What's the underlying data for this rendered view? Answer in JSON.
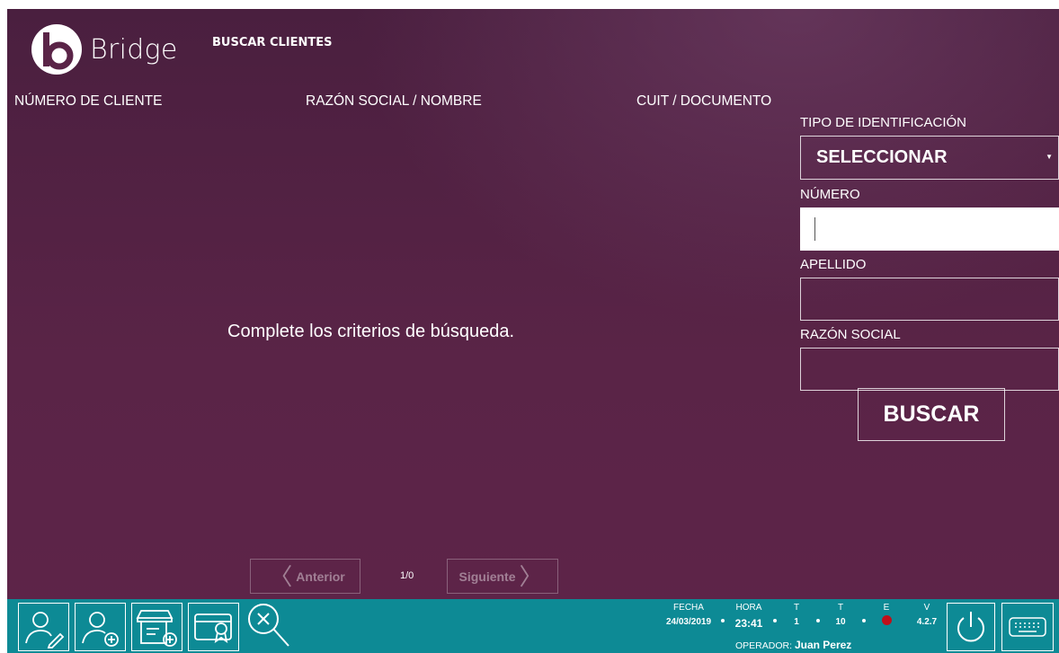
{
  "header": {
    "brand": "Bridge",
    "title": "BUSCAR CLIENTES"
  },
  "columns": [
    "NÚMERO DE CLIENTE",
    "RAZÓN SOCIAL / NOMBRE",
    "CUIT / DOCUMENTO"
  ],
  "filters": {
    "id_type_label": "TIPO DE IDENTIFICACIÓN",
    "id_type_value": "SELECCIONAR",
    "number_label": "NÚMERO",
    "number_value": "",
    "surname_label": "APELLIDO",
    "surname_value": "",
    "company_label": "RAZÓN SOCIAL",
    "company_value": "",
    "search_button": "BUSCAR"
  },
  "results": {
    "empty_message": "Complete los criterios de búsqueda."
  },
  "pagination": {
    "prev": "Anterior",
    "next": "Siguiente",
    "count": "1/0"
  },
  "toolbar": {
    "icons": [
      "edit-client-icon",
      "add-client-icon",
      "add-store-icon",
      "loyalty-card-icon",
      "search-clear-icon",
      "power-icon",
      "keyboard-icon"
    ]
  },
  "status": {
    "fecha_label": "FECHA",
    "fecha": "24/03/2019",
    "hora_label": "HORA",
    "hora": "23:41",
    "t1_label": "T",
    "t1": "1",
    "t2_label": "T",
    "t2": "10",
    "e_label": "E",
    "v_label": "V",
    "version": "4.2.7",
    "operator_label": "OPERADOR:",
    "operator": "Juan Perez"
  },
  "colors": {
    "background": "#5a2447",
    "toolbar": "#0d8a95",
    "status_led": "#c0101a"
  }
}
